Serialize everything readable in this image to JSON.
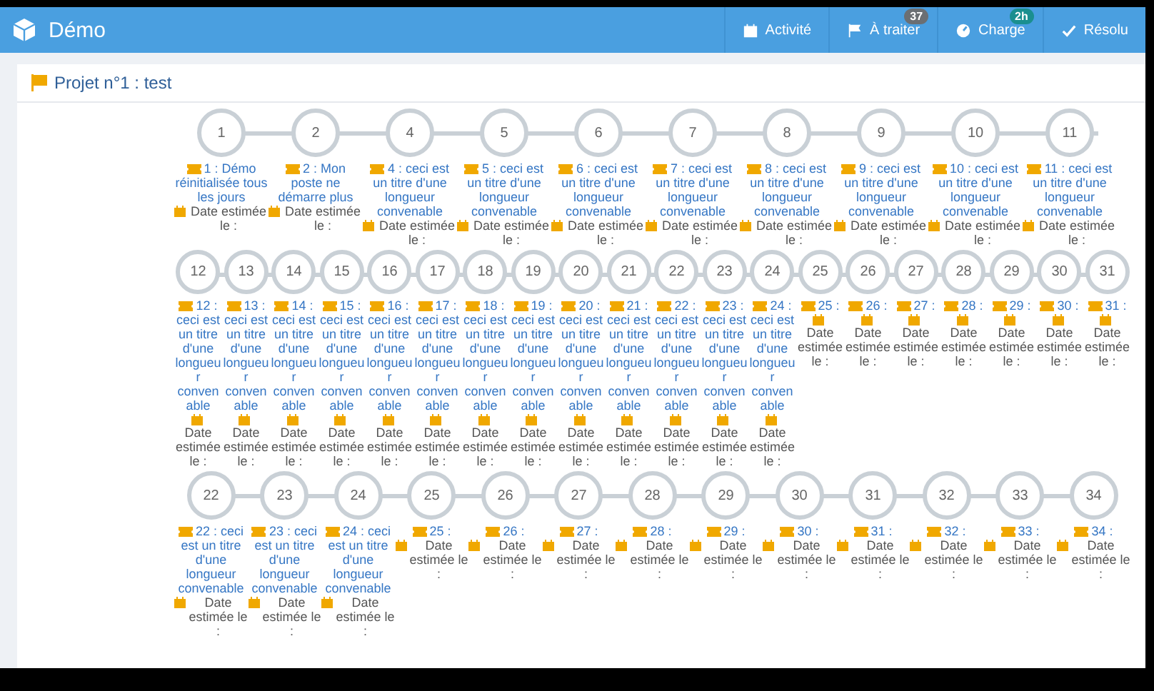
{
  "app": {
    "title": "Démo"
  },
  "nav": [
    {
      "label": "Activité",
      "kind": "calendar"
    },
    {
      "label": "À traiter",
      "kind": "flag",
      "badge": "37",
      "color": "#6b6f73"
    },
    {
      "label": "Charge",
      "kind": "gauge",
      "badge": "2h",
      "color": "#1a8f8f"
    },
    {
      "label": "Résolu",
      "kind": "check"
    }
  ],
  "project": {
    "title": "Projet n°1 : test"
  },
  "rows": [
    {
      "compact": false,
      "steps": [
        {
          "number": "1",
          "title": "1 : Démo réinitialisée tous les jours",
          "date": "Date estimée le :"
        },
        {
          "number": "2",
          "title": "2 : Mon poste ne démarre plus",
          "date": "Date estimée le :"
        },
        {
          "number": "4",
          "title": "4 : ceci est un titre d'une longueur convenable",
          "date": "Date estimée le :"
        },
        {
          "number": "5",
          "title": "5 : ceci est un titre d'une longueur convenable",
          "date": "Date estimée le :"
        },
        {
          "number": "6",
          "title": "6 : ceci est un titre d'une longueur convenable",
          "date": "Date estimée le :"
        },
        {
          "number": "7",
          "title": "7 : ceci est un titre d'une longueur convenable",
          "date": "Date estimée le :"
        },
        {
          "number": "8",
          "title": "8 : ceci est un titre d'une longueur convenable",
          "date": "Date estimée le :"
        },
        {
          "number": "9",
          "title": "9 : ceci est un titre d'une longueur convenable",
          "date": "Date estimée le :"
        },
        {
          "number": "10",
          "title": "10 : ceci est un titre d'une longueur convenable",
          "date": "Date estimée le :"
        },
        {
          "number": "11",
          "title": "11 : ceci est un titre d'une longueur convenable",
          "date": "Date estimée le :"
        }
      ]
    },
    {
      "compact": true,
      "steps": [
        {
          "number": "12",
          "title": "12 : ceci est un titre d'une longueur convenable",
          "date": "Date estimée le :"
        },
        {
          "number": "13",
          "title": "13 : ceci est un titre d'une longueur convenable",
          "date": "Date estimée le :"
        },
        {
          "number": "14",
          "title": "14 : ceci est un titre d'une longueur convenable",
          "date": "Date estimée le :"
        },
        {
          "number": "15",
          "title": "15 : ceci est un titre d'une longueur convenable",
          "date": "Date estimée le :"
        },
        {
          "number": "16",
          "title": "16 : ceci est un titre d'une longueur convenable",
          "date": "Date estimée le :"
        },
        {
          "number": "17",
          "title": "17 : ceci est un titre d'une longueur convenable",
          "date": "Date estimée le :"
        },
        {
          "number": "18",
          "title": "18 : ceci est un titre d'une longueur convenable",
          "date": "Date estimée le :"
        },
        {
          "number": "19",
          "title": "19 : ceci est un titre d'une longueur convenable",
          "date": "Date estimée le :"
        },
        {
          "number": "20",
          "title": "20 : ceci est un titre d'une longueur convenable",
          "date": "Date estimée le :"
        },
        {
          "number": "21",
          "title": "21 : ceci est un titre d'une longueur convenable",
          "date": "Date estimée le :"
        },
        {
          "number": "22",
          "title": "22 : ceci est un titre d'une longueur convenable",
          "date": "Date estimée le :"
        },
        {
          "number": "23",
          "title": "23 : ceci est un titre d'une longueur convenable",
          "date": "Date estimée le :"
        },
        {
          "number": "24",
          "title": "24 : ceci est un titre d'une longueur convenable",
          "date": "Date estimée le :"
        },
        {
          "number": "25",
          "title": "25 :",
          "date": "Date estimée le :"
        },
        {
          "number": "26",
          "title": "26 :",
          "date": "Date estimée le :"
        },
        {
          "number": "27",
          "title": "27 :",
          "date": "Date estimée le :"
        },
        {
          "number": "28",
          "title": "28 :",
          "date": "Date estimée le :"
        },
        {
          "number": "29",
          "title": "29 :",
          "date": "Date estimée le :"
        },
        {
          "number": "30",
          "title": "30 :",
          "date": "Date estimée le :"
        },
        {
          "number": "31",
          "title": "31 :",
          "date": "Date estimée le :"
        }
      ]
    },
    {
      "compact": false,
      "steps": [
        {
          "number": "22",
          "title": "22 : ceci est un titre d'une longueur convenable",
          "date": "Date estimée le :"
        },
        {
          "number": "23",
          "title": "23 : ceci est un titre d'une longueur convenable",
          "date": "Date estimée le :"
        },
        {
          "number": "24",
          "title": "24 : ceci est un titre d'une longueur convenable",
          "date": "Date estimée le :"
        },
        {
          "number": "25",
          "title": "25 :",
          "date": "Date estimée le :"
        },
        {
          "number": "26",
          "title": "26 :",
          "date": "Date estimée le :"
        },
        {
          "number": "27",
          "title": "27 :",
          "date": "Date estimée le :"
        },
        {
          "number": "28",
          "title": "28 :",
          "date": "Date estimée le :"
        },
        {
          "number": "29",
          "title": "29 :",
          "date": "Date estimée le :"
        },
        {
          "number": "30",
          "title": "30 :",
          "date": "Date estimée le :"
        },
        {
          "number": "31",
          "title": "31 :",
          "date": "Date estimée le :"
        },
        {
          "number": "32",
          "title": "32 :",
          "date": "Date estimée le :"
        },
        {
          "number": "33",
          "title": "33 :",
          "date": "Date estimée le :"
        },
        {
          "number": "34",
          "title": "34 :",
          "date": "Date estimée le :"
        }
      ]
    }
  ]
}
